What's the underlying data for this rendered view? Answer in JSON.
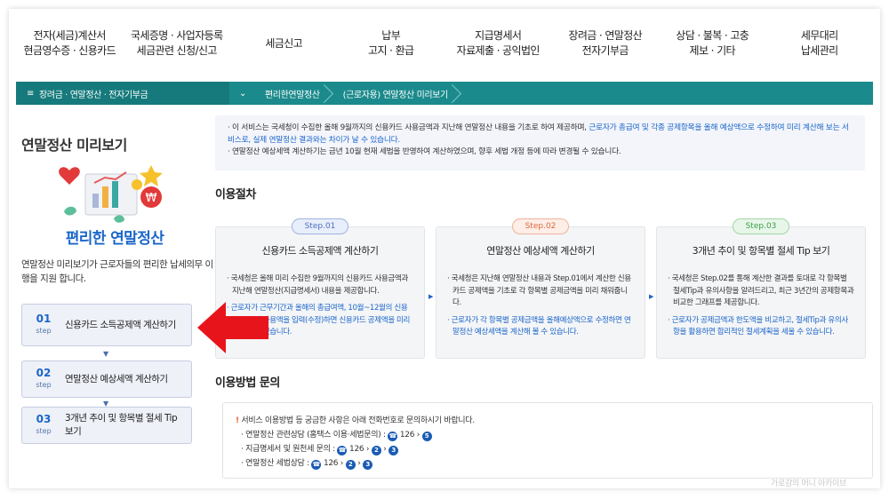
{
  "nav": [
    {
      "line1": "전자(세금)계산서",
      "line2": "현금영수증 · 신용카드"
    },
    {
      "line1": "국세증명 · 사업자등록",
      "line2": "세금관련 신청/신고"
    },
    {
      "line1": "세금신고",
      "line2": ""
    },
    {
      "line1": "납부",
      "line2": "고지 · 환급"
    },
    {
      "line1": "지급명세서",
      "line2": "자료제출 · 공익법인"
    },
    {
      "line1": "장려금 · 연말정산",
      "line2": "전자기부금"
    },
    {
      "line1": "상담 · 불복 · 고충",
      "line2": "제보 · 기타"
    },
    {
      "line1": "세무대리",
      "line2": "납세관리"
    }
  ],
  "breadcrumb": {
    "menu_icon": "≡",
    "root": "장려금 · 연말정산 · 전자기부금",
    "chevron": "⌄",
    "level2": "편리한연말정산",
    "level3": "(근로자용) 연말정산 미리보기"
  },
  "left": {
    "title": "연말정산 미리보기",
    "caption": "편리한 연말정산",
    "description": "연말정산 미리보기가 근로자들의 편리한 납세의무 이행을 지원 합니다.",
    "steps": [
      {
        "num": "01",
        "step": "step",
        "label": "신용카드 소득공제액 계산하기"
      },
      {
        "num": "02",
        "step": "step",
        "label": "연말정산 예상세액 계산하기"
      },
      {
        "num": "03",
        "step": "step",
        "label": "3개년 추이 및 항목별 절세 Tip 보기"
      }
    ],
    "down_arrow": "▼"
  },
  "notice": {
    "line1_a": "이 서비스는 국세청이 수집한 올해 9월까지의 신용카드 사용금액과 지난해 연말정산 내용을 기초로 하여 제공하며, ",
    "line1_b": "근로자가 총급여 및 각종 공제항목을 올해 예상액으로 수정하여 미리 계산해 보는 서비스로, 실제 연말정산 결과와는 차이가 날 수 있습니다.",
    "line2": "연말정산 예상세액 계산하기는 금년 10월 현재 세법을 반영하여 계산하였으며, 향후 세법 개정 등에 따라 변경될 수 있습니다."
  },
  "procedure": {
    "title": "이용절차",
    "cards": [
      {
        "badge": "Step.01",
        "title": "신용카드 소득공제액 계산하기",
        "p1": "국세청은 올해 미리 수집한 9월까지의 신용카드 사용금액과 지난해 연말정산(지급명세서) 내용을 제공합니다.",
        "p2": "근로자가 근무기간과 올해의 총급여액, 10월~12월의 신용카드 예상 사용액을 입력(수정)하면 신용카드 공제액을 미리 예상할 수 있습니다."
      },
      {
        "badge": "Step.02",
        "title": "연말정산 예상세액 계산하기",
        "p1": "국세청은 지난해 연말정산 내용과 Step.01에서 계산한 신용카드 공제액을 기초로 각 항목별 공제금액을 미리 채워줍니다.",
        "p2": "근로자가 각 항목별 공제금액을 올해예상액으로 수정하면 연말정산 예상세액을 계산해 볼 수 있습니다."
      },
      {
        "badge": "Step.03",
        "title": "3개년 추이 및 항목별 절세 Tip 보기",
        "p1": "국세청은 Step.02를 통해 계산한 결과를 토대로 각 항목별 절세Tip과 유의사항을 알려드리고, 최근 3년간의 공제항목과 비교한 그래프를 제공합니다.",
        "p2": "근로자가 공제금액과 한도액을 비교하고, 절세Tip과 유의사항을 활용하면 합리적인 절세계획을 세울 수 있습니다."
      }
    ],
    "arrow": "▶"
  },
  "inquiry": {
    "title": "이용방법 문의",
    "intro_mark": "!",
    "intro": "서비스 이용방법 등 궁금한 사항은 아래 전화번호로 문의하시기 바랍니다.",
    "rows": [
      {
        "label": "연말정산 관련상담 (홈택스 이용·세법문의) : ",
        "phone": "126",
        "steps": [
          "5"
        ]
      },
      {
        "label": "지급명세서 및 원천세 문의 : ",
        "phone": "126",
        "steps": [
          "2",
          "3"
        ]
      },
      {
        "label": "연말정산 세법상담 : ",
        "phone": "126",
        "steps": [
          "2",
          "3"
        ]
      }
    ],
    "sep": "›"
  },
  "watermark": "가로감의 머니 아카이브",
  "colors": {
    "teal_bar": "#1b8a8c",
    "link_blue": "#1b66c9",
    "step1_badge": "#4b6fc0",
    "step2_badge": "#e0673a",
    "step3_badge": "#3aa045",
    "red_arrow": "#e8141c"
  }
}
